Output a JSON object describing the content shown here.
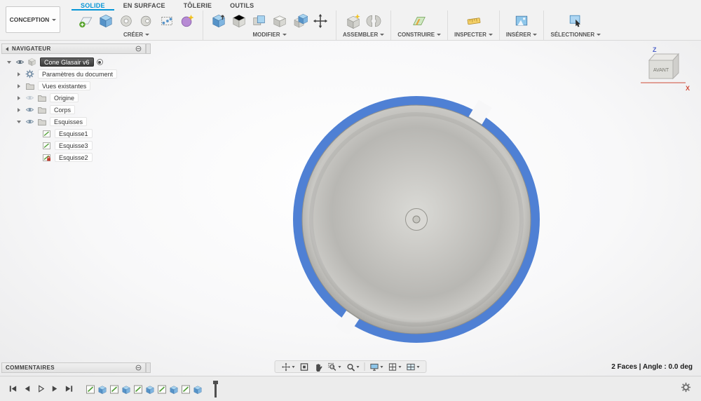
{
  "ribbon": {
    "workspace": "CONCEPTION",
    "tabs": [
      {
        "label": "SOLIDE",
        "active": true
      },
      {
        "label": "EN SURFACE",
        "active": false
      },
      {
        "label": "TÔLERIE",
        "active": false
      },
      {
        "label": "OUTILS",
        "active": false
      }
    ],
    "groups": [
      {
        "label": "CRÉER"
      },
      {
        "label": "MODIFIER"
      },
      {
        "label": "ASSEMBLER"
      },
      {
        "label": "CONSTRUIRE"
      },
      {
        "label": "INSPECTER"
      },
      {
        "label": "INSÉRER"
      },
      {
        "label": "SÉLECTIONNER"
      }
    ]
  },
  "navigator": {
    "title": "NAVIGATEUR",
    "root_label": "Cone Glasair v6",
    "items": [
      {
        "label": "Paramètres du document"
      },
      {
        "label": "Vues existantes"
      },
      {
        "label": "Origine"
      },
      {
        "label": "Corps"
      },
      {
        "label": "Esquisses"
      },
      {
        "label": "Esquisse1"
      },
      {
        "label": "Esquisse3"
      },
      {
        "label": "Esquisse2"
      }
    ]
  },
  "viewcube": {
    "front": "AVANT",
    "z": "Z",
    "x": "X"
  },
  "comments": {
    "title": "COMMENTAIRES"
  },
  "statusbar": {
    "selection": "2 Faces | Angle : 0.0 deg"
  },
  "colors": {
    "accent": "#0696d7",
    "selection_blue": "#4f80d4",
    "axis_x": "#cf4b38",
    "axis_z": "#4b5fc8"
  }
}
